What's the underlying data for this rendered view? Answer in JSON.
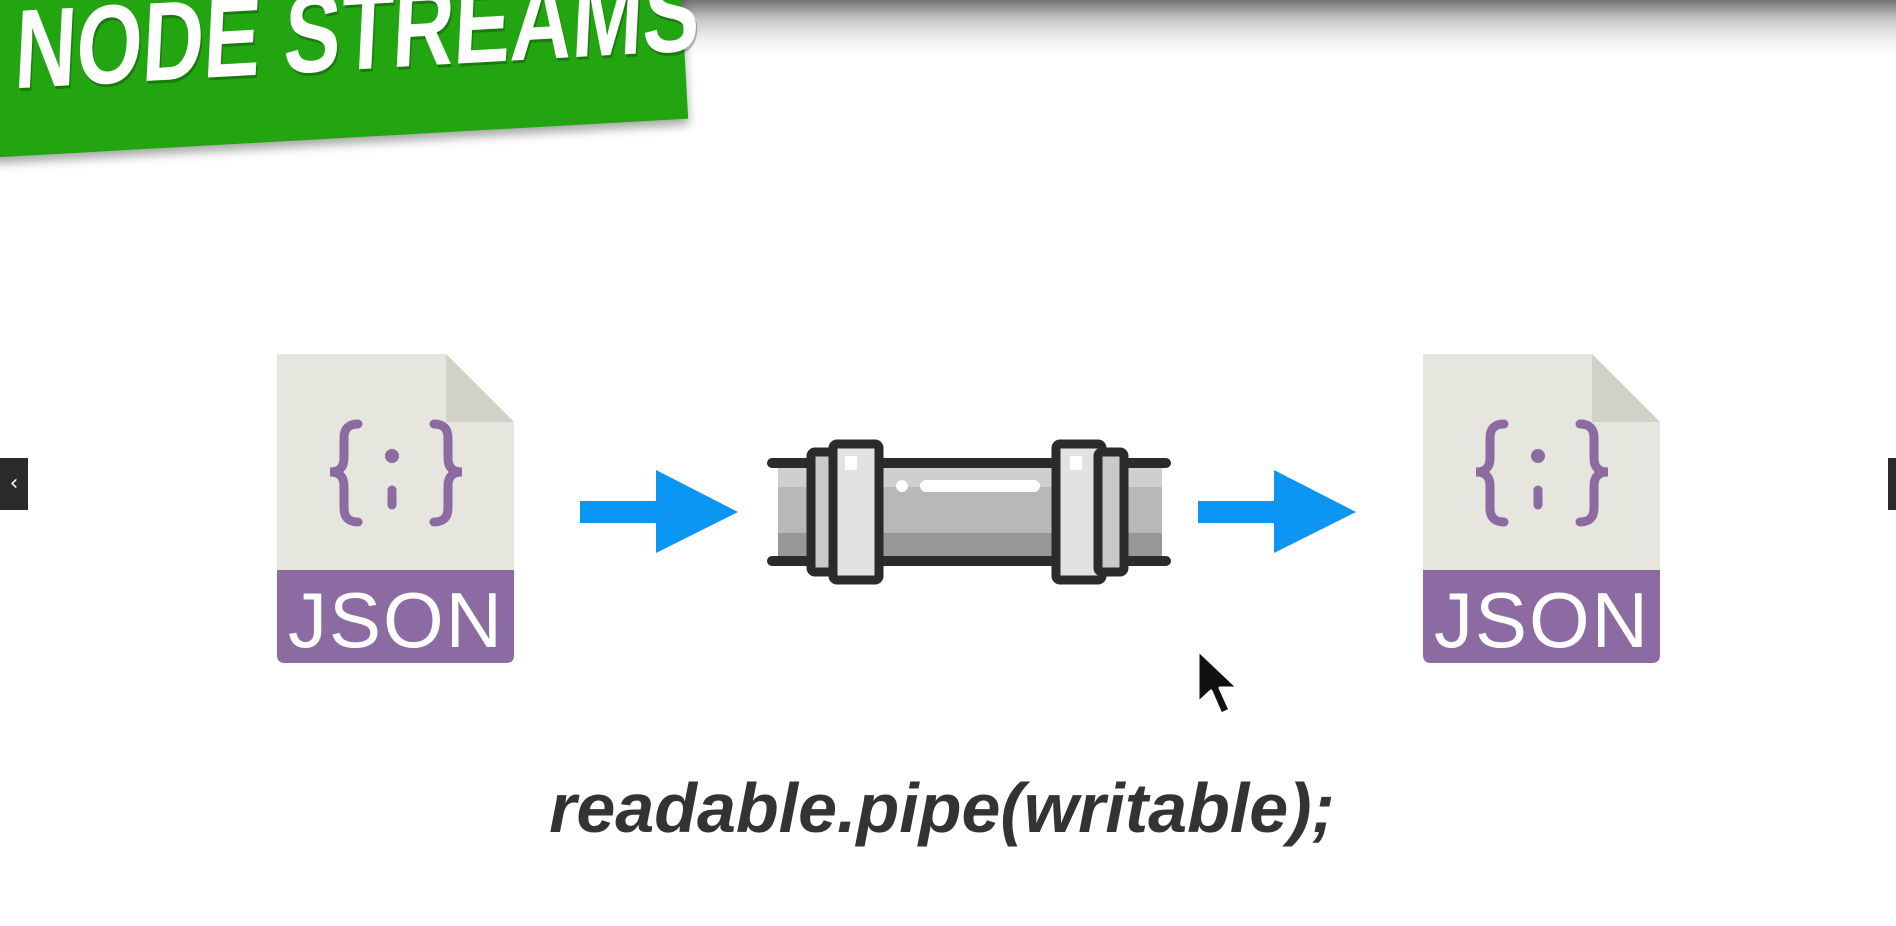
{
  "banner": {
    "title": "NODE STREAMS"
  },
  "diagram": {
    "source_file_label": "JSON",
    "target_file_label": "JSON"
  },
  "code": {
    "line": "readable.pipe(writable);"
  },
  "navigation": {
    "prev_glyph": "‹"
  },
  "colors": {
    "banner_green": "#22a511",
    "file_body": "#e6e5de",
    "file_fold": "#d2d1c7",
    "file_band": "#8c6ba3",
    "brace_purple": "#8c6ba3",
    "arrow_blue": "#0a96f2",
    "pipe_dark": "#2b2b2b",
    "pipe_gray": "#a8a8a8",
    "pipe_light": "#dcdcdc",
    "code_text": "#333333"
  },
  "icons": {
    "source": "json-file-icon",
    "target": "json-file-icon",
    "pipe": "pipe-icon",
    "arrow": "right-arrow-icon",
    "cursor": "mouse-pointer-icon"
  }
}
